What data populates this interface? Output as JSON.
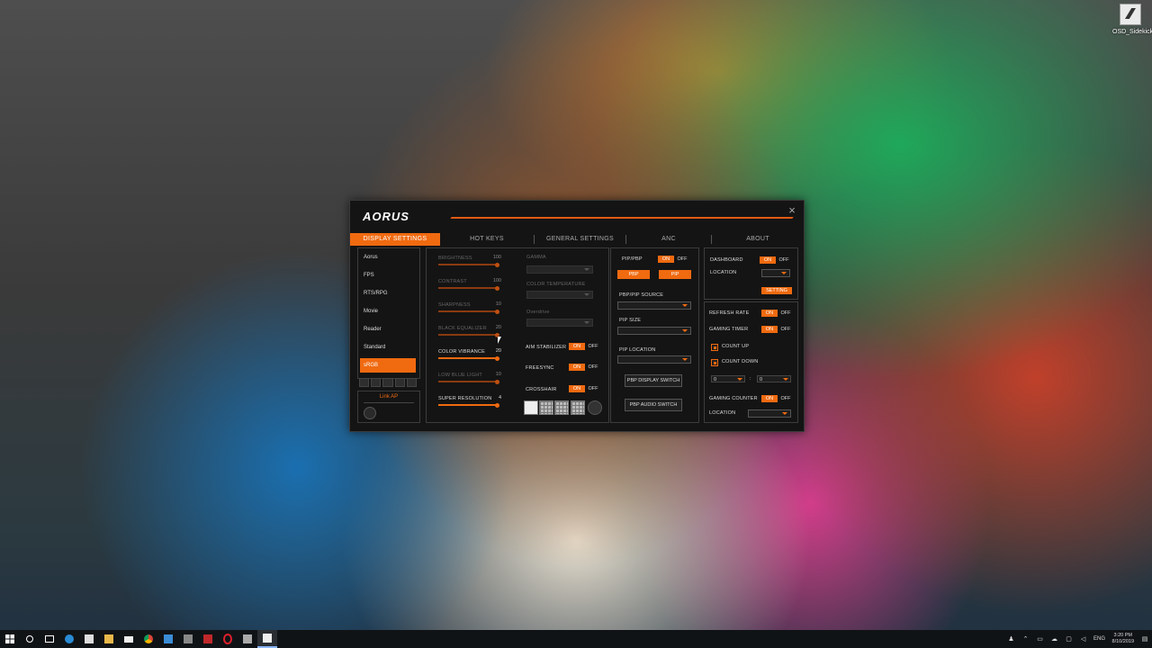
{
  "desktop": {
    "icon_label": "OSD_Sidekick"
  },
  "app": {
    "logo": "AORUS",
    "tabs": [
      "DISPLAY SETTINGS",
      "HOT KEYS",
      "GENERAL SETTINGS",
      "ANC",
      "ABOUT"
    ],
    "active_tab": "DISPLAY SETTINGS",
    "modes": [
      "Aorus",
      "FPS",
      "RTS/RPG",
      "Movie",
      "Reader",
      "Standard",
      "sRGB"
    ],
    "active_mode": "sRGB",
    "link_ap": "Link AP",
    "sliders": [
      {
        "label": "BRIGHTNESS",
        "value": "100",
        "level": 1.0,
        "enabled": false
      },
      {
        "label": "CONTRAST",
        "value": "100",
        "level": 1.0,
        "enabled": false
      },
      {
        "label": "SHARPNESS",
        "value": "10",
        "level": 1.0,
        "enabled": false
      },
      {
        "label": "BLACK EQUALIZER",
        "value": "20",
        "level": 1.0,
        "enabled": false
      },
      {
        "label": "COLOR VIBRANCE",
        "value": "20",
        "level": 1.0,
        "enabled": true
      },
      {
        "label": "LOW BLUE LIGHT",
        "value": "10",
        "level": 1.0,
        "enabled": false
      },
      {
        "label": "SUPER RESOLUTION",
        "value": "4",
        "level": 1.0,
        "enabled": true
      }
    ],
    "dropdowns": {
      "gamma": "GAMMA",
      "color_temperature": "COLOR TEMPERATURE",
      "overdrive": "Overdrive"
    },
    "toggles_mid": {
      "aim_stabilizer": "AIM STABILIZER",
      "freesync": "FREESYNC",
      "crosshair": "CROSSHAIR"
    },
    "on": "ON",
    "off": "OFF",
    "pip": {
      "pip_pbp": "PIP/PBP",
      "pbp_button": "PBP",
      "pip_button": "PIP",
      "source": "PBP/PIP SOURCE",
      "size": "PIP SIZE",
      "location": "PIP LOCATION",
      "display_switch": "PBP DISPLAY SWITCH",
      "audio_switch": "PBP AUDIO SWITCH"
    },
    "dashboard": {
      "label": "DASHBOARD",
      "location": "LOCATION",
      "setting": "SETTING"
    },
    "timer": {
      "refresh_rate": "REFRESH RATE",
      "gaming_timer": "GAMING TIMER",
      "count_up": "COUNT UP",
      "count_down": "COUNT DOWN",
      "minutes": "0",
      "colon": ":",
      "seconds": "0",
      "gaming_counter": "GAMING COUNTER",
      "location": "LOCATION"
    }
  },
  "taskbar": {
    "lang": "ENG",
    "time": "3:20 PM",
    "date": "8/10/2019"
  }
}
